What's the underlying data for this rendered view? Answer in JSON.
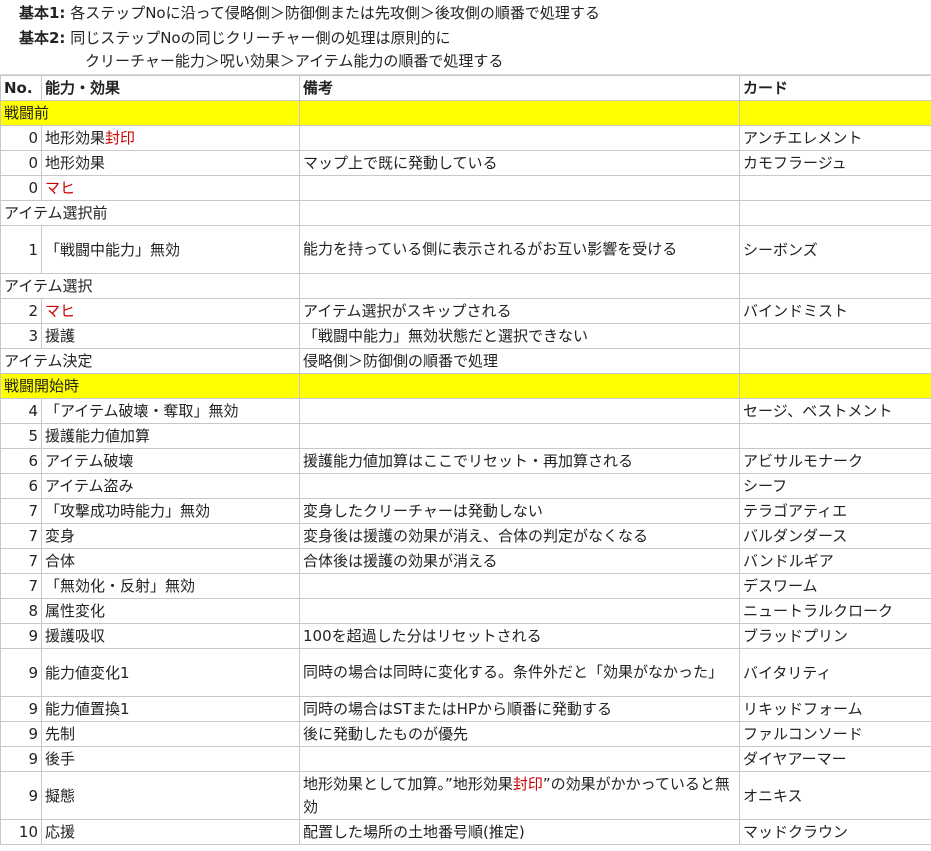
{
  "notes": {
    "n1_label": "基本1:",
    "n1_text": " 各ステップNoに沿って侵略側＞防御側または先攻側＞後攻側の順番で処理する",
    "n2_label": "基本2:",
    "n2_text": " 同じステップNoの同じクリーチャー側の処理は原則的に",
    "n3_text": "クリーチャー能力＞呪い効果＞アイテム能力の順番で処理する"
  },
  "headers": [
    "No.",
    "能力・効果",
    "備考",
    "カード"
  ],
  "rows": [
    {
      "type": "section",
      "yellow": true,
      "label": "戦闘前"
    },
    {
      "no": "0",
      "ability": "地形効果",
      "ability_red": "封印",
      "note": "",
      "card": "アンチエレメント"
    },
    {
      "no": "0",
      "ability": "地形効果",
      "note": "マップ上で既に発動している",
      "card": "カモフラージュ"
    },
    {
      "no": "0",
      "ability": "",
      "ability_red": "マヒ",
      "note": "",
      "card": ""
    },
    {
      "type": "section",
      "label": "アイテム選択前"
    },
    {
      "no": "1",
      "ability": "「戦闘中能力」無効",
      "note": "能力を持っている側に表示されるがお互い影響を受ける",
      "card": "シーボンズ",
      "tall": true
    },
    {
      "type": "section",
      "label": "アイテム選択"
    },
    {
      "no": "2",
      "ability": "",
      "ability_red": "マヒ",
      "note": "アイテム選択がスキップされる",
      "card": "バインドミスト"
    },
    {
      "no": "3",
      "ability": "援護",
      "note": "「戦闘中能力」無効状態だと選択できない",
      "card": ""
    },
    {
      "type": "section",
      "label": "アイテム決定",
      "note": "侵略側＞防御側の順番で処理"
    },
    {
      "type": "section",
      "yellow": true,
      "label": "戦闘開始時"
    },
    {
      "no": "4",
      "ability": "「アイテム破壊・奪取」無効",
      "note": "",
      "card": "セージ、ベストメント"
    },
    {
      "no": "5",
      "ability": "援護能力値加算",
      "note": "",
      "card": ""
    },
    {
      "no": "6",
      "ability": "アイテム破壊",
      "note": "援護能力値加算はここでリセット・再加算される",
      "card": "アビサルモナーク"
    },
    {
      "no": "6",
      "ability": "アイテム盗み",
      "note": "",
      "card": "シーフ"
    },
    {
      "no": "7",
      "ability": "「攻撃成功時能力」無効",
      "note": "変身したクリーチャーは発動しない",
      "card": "テラゴアティエ"
    },
    {
      "no": "7",
      "ability": "変身",
      "note": "変身後は援護の効果が消え、合体の判定がなくなる",
      "card": "バルダンダース"
    },
    {
      "no": "7",
      "ability": "合体",
      "note": "合体後は援護の効果が消える",
      "card": "バンドルギア"
    },
    {
      "no": "7",
      "ability": "「無効化・反射」無効",
      "note": "",
      "card": "デスワーム"
    },
    {
      "no": "8",
      "ability": "属性変化",
      "note": "",
      "card": "ニュートラルクローク"
    },
    {
      "no": "9",
      "ability": "援護吸収",
      "note": "100を超過した分はリセットされる",
      "card": "ブラッドプリン"
    },
    {
      "no": "9",
      "ability": "能力値変化1",
      "note": "同時の場合は同時に変化する。条件外だと「効果がなかった」",
      "card": "バイタリティ",
      "tall": true
    },
    {
      "no": "9",
      "ability": "能力値置換1",
      "note": "同時の場合はSTまたはHPから順番に発動する",
      "card": "リキッドフォーム"
    },
    {
      "no": "9",
      "ability": "先制",
      "note": "後に発動したものが優先",
      "card": "ファルコンソード"
    },
    {
      "no": "9",
      "ability": "後手",
      "note": "",
      "card": "ダイヤアーマー"
    },
    {
      "no": "9",
      "ability": "擬態",
      "note_pre": "地形効果として加算。”地形効果",
      "note_red": "封印",
      "note_post": "”の効果がかかっていると無効",
      "card": "オニキス",
      "tall": true
    },
    {
      "no": "10",
      "ability": "応援",
      "note": "配置した場所の土地番号順(推定)",
      "card": "マッドクラウン"
    }
  ]
}
